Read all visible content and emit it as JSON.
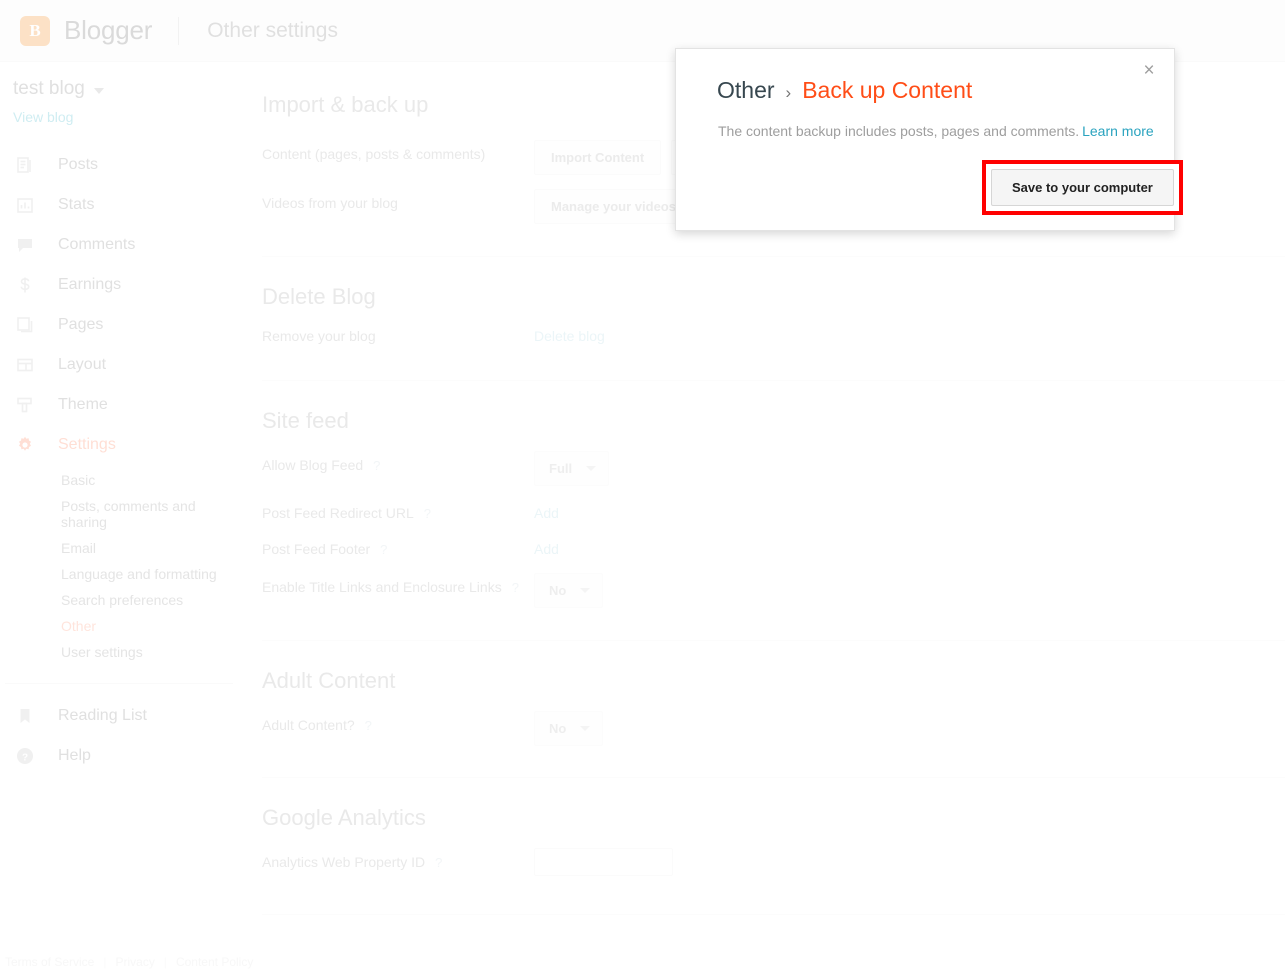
{
  "topbar": {
    "logo_icon": "blogger-logo-icon",
    "logo_letter": "B",
    "brand": "Blogger",
    "page_title": "Other settings"
  },
  "sidebar": {
    "blog_name": "test blog",
    "blog_caret_icon": "chevron-down-icon",
    "view_blog": "View blog",
    "items": [
      {
        "label": "Posts",
        "icon": "posts-icon",
        "active": false
      },
      {
        "label": "Stats",
        "icon": "stats-icon",
        "active": false
      },
      {
        "label": "Comments",
        "icon": "comments-icon",
        "active": false
      },
      {
        "label": "Earnings",
        "icon": "dollar-icon",
        "active": false
      },
      {
        "label": "Pages",
        "icon": "pages-icon",
        "active": false
      },
      {
        "label": "Layout",
        "icon": "layout-icon",
        "active": false
      },
      {
        "label": "Theme",
        "icon": "theme-icon",
        "active": false
      },
      {
        "label": "Settings",
        "icon": "gear-icon",
        "active": true
      }
    ],
    "settings_subitems": [
      {
        "label": "Basic",
        "active": false
      },
      {
        "label": "Posts, comments and sharing",
        "active": false
      },
      {
        "label": "Email",
        "active": false
      },
      {
        "label": "Language and formatting",
        "active": false
      },
      {
        "label": "Search preferences",
        "active": false
      },
      {
        "label": "Other",
        "active": true
      },
      {
        "label": "User settings",
        "active": false
      }
    ],
    "bottom_items": [
      {
        "label": "Reading List",
        "icon": "bookmark-icon"
      },
      {
        "label": "Help",
        "icon": "help-circle-icon"
      }
    ]
  },
  "main": {
    "sections": [
      {
        "heading": "Import & back up",
        "rows": [
          {
            "label": "Content (pages, posts & comments)",
            "buttons": [
              "Import Content",
              "Back up Content"
            ]
          },
          {
            "label": "Videos from your blog",
            "buttons": [
              "Manage your videos"
            ]
          }
        ]
      },
      {
        "heading": "Delete Blog",
        "rows": [
          {
            "label": "Remove your blog",
            "link": "Delete blog"
          }
        ]
      },
      {
        "heading": "Site feed",
        "rows": [
          {
            "label": "Allow Blog Feed",
            "help": "?",
            "select": "Full"
          },
          {
            "label": "Post Feed Redirect URL",
            "help": "?",
            "link": "Add"
          },
          {
            "label": "Post Feed Footer",
            "help": "?",
            "link": "Add"
          },
          {
            "label": "Enable Title Links and Enclosure Links",
            "help": "?",
            "select": "No"
          }
        ]
      },
      {
        "heading": "Adult Content",
        "rows": [
          {
            "label": "Adult Content?",
            "help": "?",
            "select": "No"
          }
        ]
      },
      {
        "heading": "Google Analytics",
        "rows": [
          {
            "label": "Analytics Web Property ID",
            "help": "?",
            "input_value": ""
          }
        ]
      }
    ]
  },
  "footer": {
    "terms": "Terms of Service",
    "privacy": "Privacy",
    "content_policy": "Content Policy",
    "separator": "|"
  },
  "modal": {
    "close_icon": "close-icon",
    "close_glyph": "×",
    "breadcrumb_root": "Other",
    "breadcrumb_chevron": "›",
    "breadcrumb_leaf": "Back up Content",
    "description": "The content backup includes posts, pages and comments.",
    "learn_more": "Learn more",
    "save_button": "Save to your computer",
    "highlight_color": "#ff0000"
  }
}
